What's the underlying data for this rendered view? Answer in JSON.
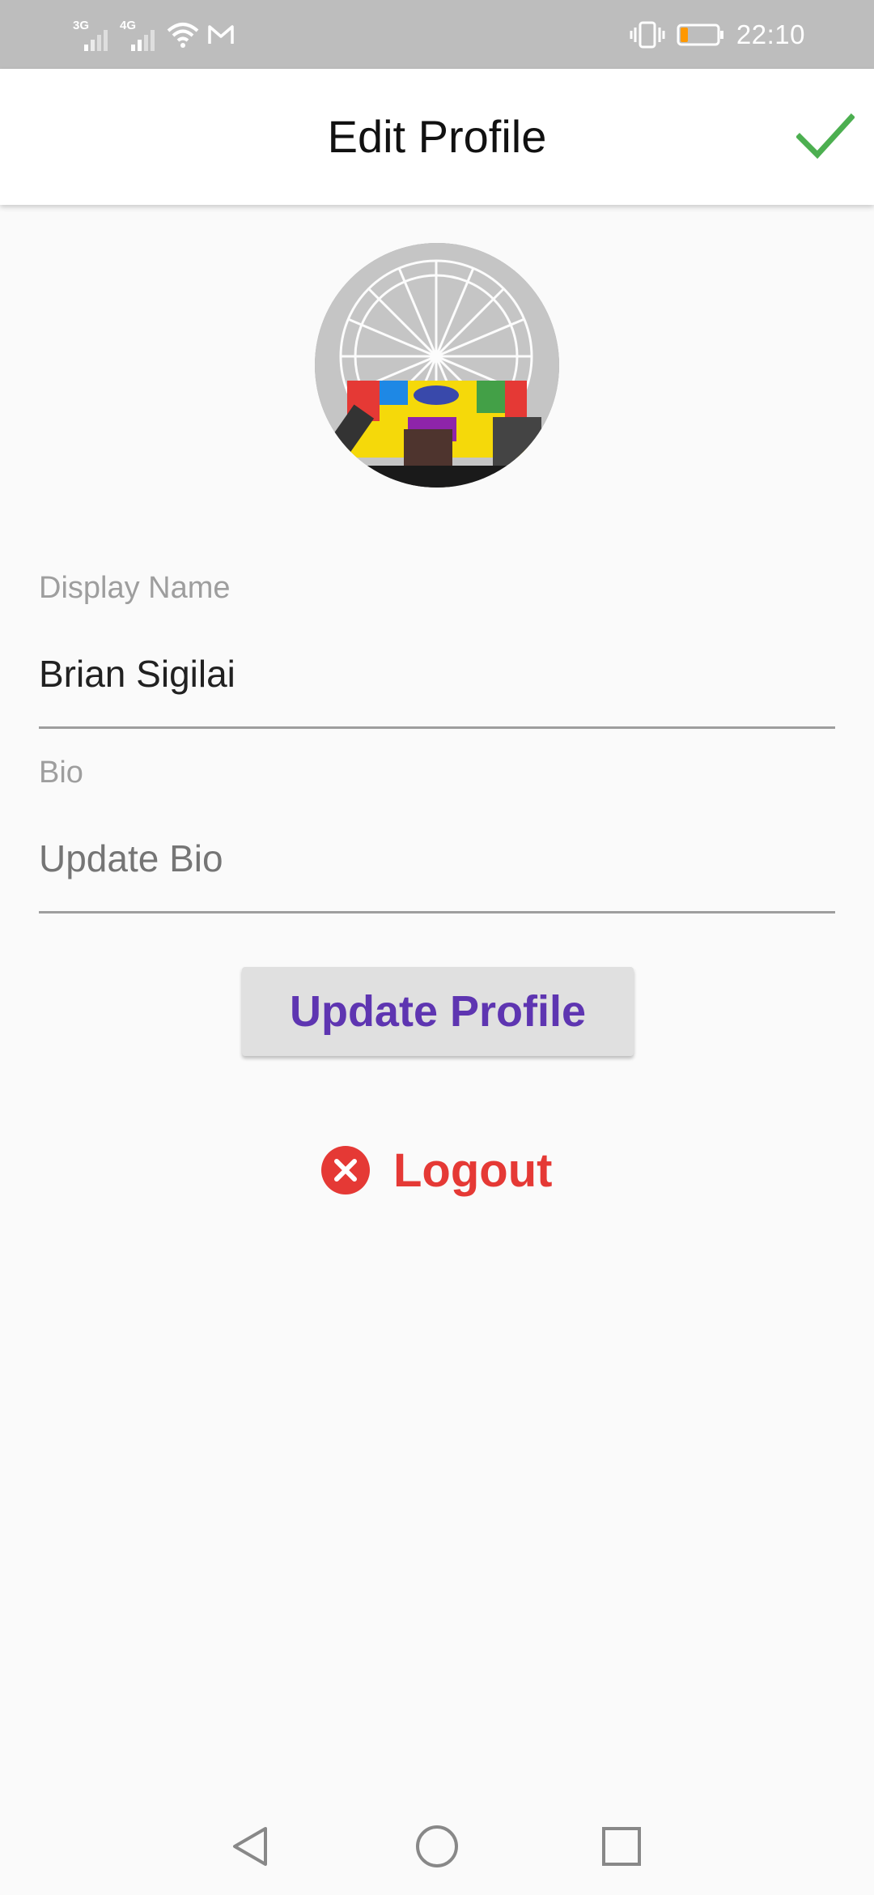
{
  "status_bar": {
    "signal_1_tag": "3G",
    "signal_2_tag": "4G",
    "icons": [
      "signal-icon",
      "signal-icon",
      "wifi-icon",
      "mail-icon",
      "vibrate-icon",
      "battery-icon"
    ],
    "time": "22:10"
  },
  "app_bar": {
    "title": "Edit Profile",
    "confirm_icon": "check-icon",
    "accent": "#4caf50"
  },
  "avatar": {
    "alt": "Profile photo"
  },
  "form": {
    "display_name": {
      "label": "Display Name",
      "value": "Brian Sigilai"
    },
    "bio": {
      "label": "Bio",
      "placeholder": "Update Bio",
      "value": ""
    }
  },
  "actions": {
    "update_label": "Update Profile",
    "update_color": "#5e35b1",
    "logout_label": "Logout",
    "logout_color": "#e53935",
    "logout_icon": "cancel-icon"
  },
  "nav_bar": {
    "icons": [
      "back-icon",
      "home-icon",
      "recents-icon"
    ]
  }
}
